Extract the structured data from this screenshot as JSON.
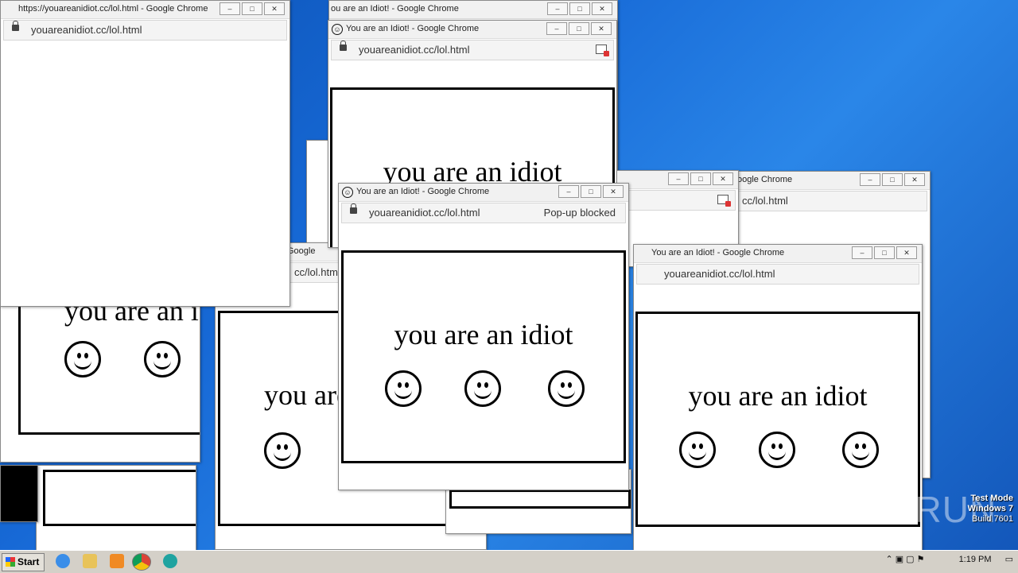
{
  "url": "youareanidiot.cc/lol.html",
  "url_full": "https://youareanidiot.cc/lol.html - Google Chrome",
  "title": "You are an Idiot! - Google Chrome",
  "title_cut1": "ou are an Idiot! - Google Chrome",
  "title_cut2": "oogle Chrome",
  "url_cut": "cc/lol.html",
  "popup_blocked": "Pop-up blocked",
  "message": "you are an idiot",
  "taskbar": {
    "start": "Start",
    "clock": "1:19 PM"
  },
  "watermark": {
    "line1": "Test Mode",
    "line2": "Windows 7",
    "line3": "Build 7601"
  },
  "brand": "ANY RUN"
}
